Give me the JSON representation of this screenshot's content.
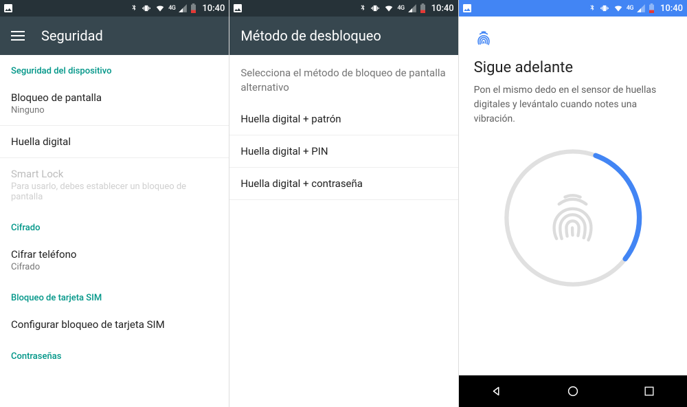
{
  "status": {
    "time": "10:40",
    "network": "4G"
  },
  "screen1": {
    "title": "Seguridad",
    "sec_device": "Seguridad del dispositivo",
    "screenlock": {
      "title": "Bloqueo de pantalla",
      "sub": "Ninguno"
    },
    "fingerprint": {
      "title": "Huella digital"
    },
    "smartlock": {
      "title": "Smart Lock",
      "sub": "Para usarlo, debes establecer un bloqueo de pantalla"
    },
    "sec_encrypt": "Cifrado",
    "encrypt": {
      "title": "Cifrar teléfono",
      "sub": "Cifrado"
    },
    "sec_sim": "Bloqueo de tarjeta SIM",
    "sim": {
      "title": "Configurar bloqueo de tarjeta SIM"
    },
    "sec_passwords": "Contraseñas"
  },
  "screen2": {
    "title": "Método de desbloqueo",
    "subtitle": "Selecciona el método de bloqueo de pantalla alternativo",
    "opt_pattern": "Huella digital + patrón",
    "opt_pin": "Huella digital + PIN",
    "opt_password": "Huella digital + contraseña"
  },
  "screen3": {
    "title": "Sigue adelante",
    "text": "Pon el mismo dedo en el sensor de huellas digitales y levántalo cuando notes una vibración.",
    "progress_percent": 30
  },
  "colors": {
    "accent": "#009688",
    "blue": "#4285f4",
    "appbar": "#37474F"
  }
}
